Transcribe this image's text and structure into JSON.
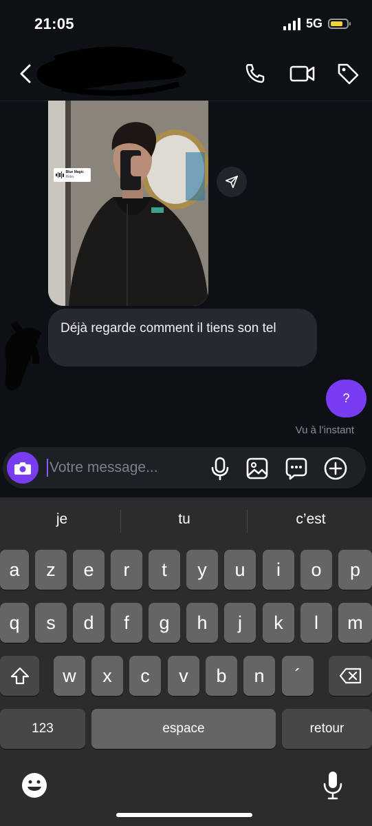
{
  "status_bar": {
    "time": "21:05",
    "network": "5G",
    "battery_level": 0.75
  },
  "header": {
    "contact_name_redacted": true
  },
  "photo_message": {
    "music_sticker": {
      "title": "Blue Magic",
      "artist": "Roko"
    }
  },
  "messages": [
    {
      "from": "them",
      "text": "Déjà regarde comment il tiens son tel"
    },
    {
      "from": "me",
      "text": "?"
    }
  ],
  "read_receipt": "Vu à l’instant",
  "composer": {
    "placeholder": "Votre message..."
  },
  "keyboard": {
    "suggestions": [
      "je",
      "tu",
      "c’est"
    ],
    "row1": [
      "a",
      "z",
      "e",
      "r",
      "t",
      "y",
      "u",
      "i",
      "o",
      "p"
    ],
    "row2": [
      "q",
      "s",
      "d",
      "f",
      "g",
      "h",
      "j",
      "k",
      "l",
      "m"
    ],
    "row3": [
      "w",
      "x",
      "c",
      "v",
      "b",
      "n",
      "´"
    ],
    "numbers_label": "123",
    "space_label": "espace",
    "return_label": "retour"
  },
  "colors": {
    "accent": "#7a3cf3",
    "background": "#0d1014",
    "bubble": "#262a30"
  }
}
